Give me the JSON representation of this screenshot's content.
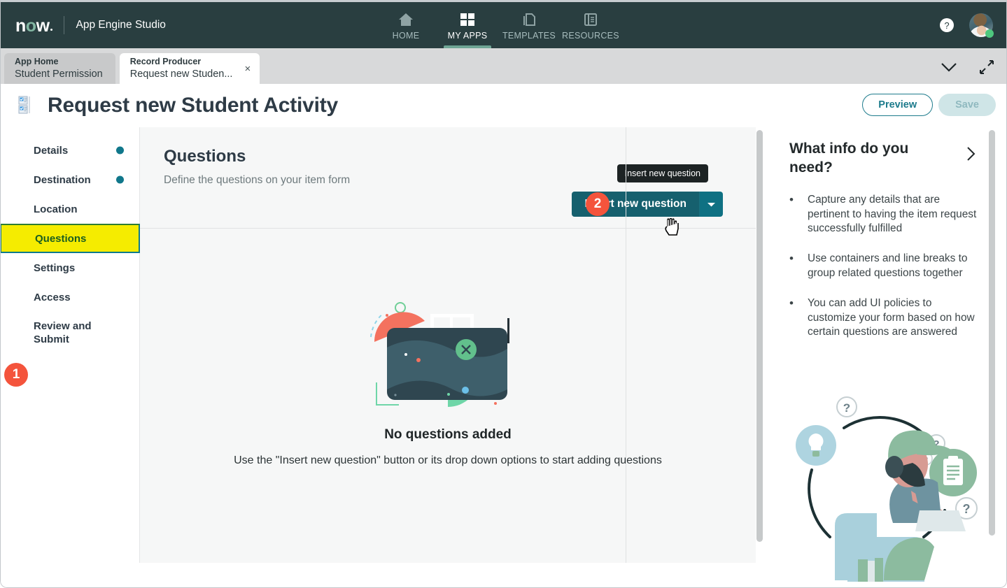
{
  "topbar": {
    "logo_text": "now",
    "app_name": "App Engine Studio",
    "nav": [
      {
        "label": "HOME",
        "icon": "home-icon",
        "active": false
      },
      {
        "label": "MY APPS",
        "icon": "grid-icon",
        "active": true
      },
      {
        "label": "TEMPLATES",
        "icon": "templates-icon",
        "active": false
      },
      {
        "label": "RESOURCES",
        "icon": "resources-icon",
        "active": false
      }
    ],
    "help_glyph": "?",
    "bg_color": "#293e40"
  },
  "tabs": {
    "items": [
      {
        "top": "App Home",
        "bottom": "Student Permission",
        "active": false
      },
      {
        "top": "Record Producer",
        "bottom": "Request new Studen...",
        "active": true
      }
    ],
    "close_glyph": "×"
  },
  "titlebar": {
    "title": "Request new Student Activity",
    "preview_label": "Preview",
    "save_label": "Save",
    "accent_color": "#1d7b8c"
  },
  "sidebar": {
    "items": [
      {
        "label": "Details",
        "dot": true,
        "highlight": false
      },
      {
        "label": "Destination",
        "dot": true,
        "highlight": false
      },
      {
        "label": "Location",
        "dot": false,
        "highlight": false
      },
      {
        "label": "Questions",
        "dot": false,
        "highlight": true
      },
      {
        "label": "Settings",
        "dot": false,
        "highlight": false
      },
      {
        "label": "Access",
        "dot": false,
        "highlight": false
      },
      {
        "label": "Review and Submit",
        "dot": false,
        "highlight": false
      }
    ]
  },
  "annotations": {
    "badge_1": "1",
    "badge_2": "2",
    "badge_color": "#f4543c"
  },
  "questions": {
    "heading": "Questions",
    "subheading": "Define the questions on your item form",
    "insert_label": "Insert new question",
    "insert_tooltip": "Insert new question",
    "empty_title": "No questions added",
    "empty_sub": "Use the \"Insert new question\" button or its drop down options to start adding questions"
  },
  "info_panel": {
    "title": "What info do you need?",
    "bullets": [
      "Capture any details that are pertinent to having the item request successfully fulfilled",
      "Use containers and line breaks to group related questions together",
      "You can add UI policies to customize your form based on how certain questions are answered"
    ]
  }
}
